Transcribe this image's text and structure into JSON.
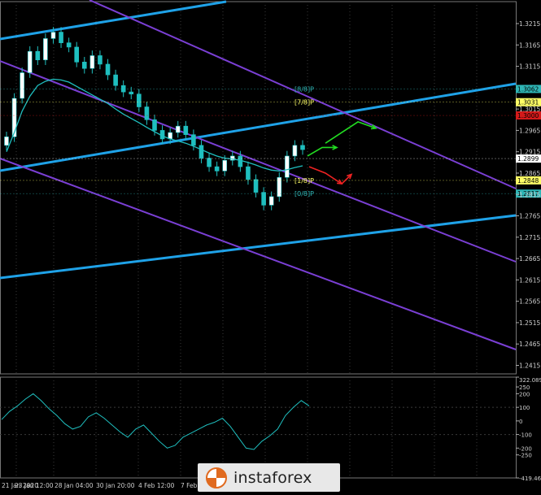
{
  "chart_data": [
    {
      "type": "line",
      "panel": "price",
      "ylim": [
        1.2395,
        1.3255
      ],
      "y_tick_labels": [
        "1.3215",
        "1.3165",
        "1.3115",
        "1.3015",
        "1.2965",
        "1.2915",
        "1.2865",
        "1.2815",
        "1.2765",
        "1.2715",
        "1.2665",
        "1.2615",
        "1.2565",
        "1.2515",
        "1.2465",
        "1.2415"
      ],
      "y_ticks": [
        1.3215,
        1.3165,
        1.3115,
        1.3015,
        1.2965,
        1.2915,
        1.2865,
        1.2815,
        1.2765,
        1.2715,
        1.2665,
        1.2615,
        1.2565,
        1.2515,
        1.2465,
        1.2415
      ],
      "x_tick_labels": [
        "21 Jan 2020",
        "23 Jan 12:00",
        "28 Jan 04:00",
        "30 Jan 20:00",
        "4 Feb 12:00",
        "7 Feb"
      ],
      "price_badges": [
        {
          "value": "1.3062",
          "price": 1.3062,
          "color": "#2fb6b6"
        },
        {
          "value": "1.3031",
          "price": 1.3031,
          "color": "#ffff66"
        },
        {
          "value": "1.3000",
          "price": 1.3,
          "color": "#d41a1a"
        },
        {
          "value": "1.2899",
          "price": 1.2899,
          "color": "#ffffff"
        },
        {
          "value": "1.2848",
          "price": 1.2848,
          "color": "#ffff66"
        },
        {
          "value": "1.2817",
          "price": 1.2817,
          "color": "#2fb6b6"
        }
      ],
      "murrey_levels": [
        {
          "label": "[8/8]P",
          "price": 1.3062,
          "color": "#2fb6b6"
        },
        {
          "label": "[7/8]P",
          "price": 1.3031,
          "color": "#ffff66"
        },
        {
          "label": "[1/8]P",
          "price": 1.2848,
          "color": "#ffff66"
        },
        {
          "label": "[0/8]P",
          "price": 1.2817,
          "color": "#2fb6b6"
        }
      ],
      "series": [
        {
          "values": [
            1.295,
            1.304,
            1.31,
            1.315,
            1.313,
            1.318,
            1.3195,
            1.317,
            1.316,
            1.3125,
            1.311,
            1.314,
            1.312,
            1.3095,
            1.307,
            1.3055,
            1.305,
            1.302,
            1.299,
            1.2965,
            1.2945,
            1.296,
            1.2975,
            1.2955,
            1.293,
            1.29,
            1.288,
            1.287,
            1.2895,
            1.2905,
            1.288,
            1.285,
            1.282,
            1.279,
            1.281,
            1.2855,
            1.2905,
            1.293,
            1.292
          ]
        },
        {
          "values": [
            1.2915,
            1.296,
            1.301,
            1.3045,
            1.307,
            1.308,
            1.3085,
            1.3083,
            1.3078,
            1.3068,
            1.3058,
            1.3048,
            1.3038,
            1.3028,
            1.3015,
            1.3003,
            1.2993,
            1.2983,
            1.2972,
            1.2962,
            1.2952,
            1.2945,
            1.294,
            1.2935,
            1.2928,
            1.292,
            1.2912,
            1.2905,
            1.29,
            1.2898,
            1.2895,
            1.289,
            1.2884,
            1.2877,
            1.2872,
            1.287,
            1.2873,
            1.2878,
            1.2882
          ]
        }
      ],
      "forecast_arrows": [
        {
          "color": "#22dd22",
          "direction": "up"
        },
        {
          "color": "#ee2222",
          "direction": "down"
        }
      ]
    },
    {
      "type": "line",
      "panel": "oscillator",
      "ylim": [
        -419.46,
        322.0896
      ],
      "y_tick_labels": [
        "322.0896",
        "250",
        "200",
        "100",
        "0",
        "-100",
        "-200",
        "-250",
        "-419.460"
      ],
      "y_ticks": [
        322.0896,
        250,
        200,
        100,
        0,
        -100,
        -200,
        -250,
        -419.46
      ],
      "series": [
        {
          "values": [
            10,
            70,
            110,
            160,
            200,
            150,
            90,
            40,
            -20,
            -60,
            -40,
            30,
            60,
            20,
            -30,
            -80,
            -120,
            -60,
            -30,
            -90,
            -150,
            -200,
            -180,
            -120,
            -90,
            -60,
            -30,
            -10,
            20,
            -40,
            -120,
            -200,
            -210,
            -150,
            -110,
            -60,
            40,
            100,
            150,
            110
          ]
        }
      ]
    }
  ],
  "logo": {
    "text": "instaforex"
  },
  "colors": {
    "background": "#000000",
    "channel_lines": "#7a3fd4",
    "trend_lines": "#1fa2e8",
    "candles": "#1fbfbf",
    "moving_average": "#1fbfbf",
    "oscillator": "#1fbfbf"
  }
}
